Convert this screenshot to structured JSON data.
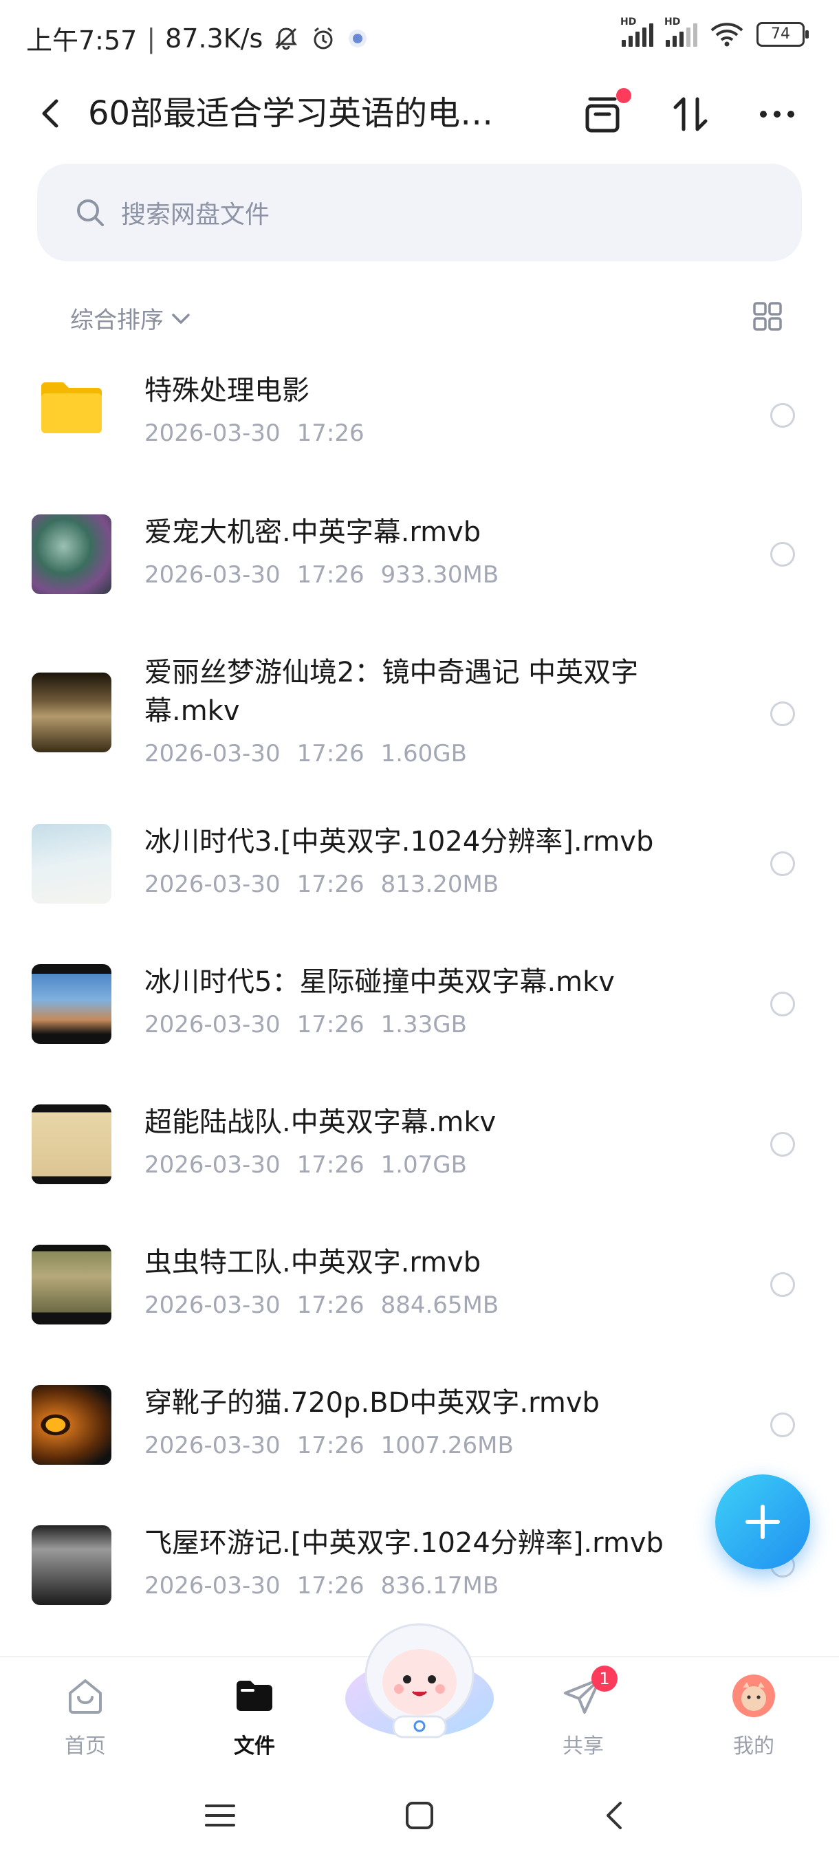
{
  "status_bar": {
    "time": "上午7:57",
    "net_speed": "87.3K/s",
    "battery": "74",
    "signal_tag": "HD"
  },
  "header": {
    "title": "60部最适合学习英语的电…"
  },
  "search": {
    "placeholder": "搜索网盘文件"
  },
  "sort": {
    "label": "综合排序"
  },
  "files": [
    {
      "name": "特殊处理电影",
      "date": "2026-03-30",
      "time": "17:26",
      "size": "",
      "type": "folder"
    },
    {
      "name": "爱宠大机密.中英字幕.rmvb",
      "date": "2026-03-30",
      "time": "17:26",
      "size": "933.30MB",
      "type": "video"
    },
    {
      "name": "爱丽丝梦游仙境2：镜中奇遇记 中英双字幕.mkv",
      "date": "2026-03-30",
      "time": "17:26",
      "size": "1.60GB",
      "type": "video"
    },
    {
      "name": "冰川时代3.[中英双字.1024分辨率].rmvb",
      "date": "2026-03-30",
      "time": "17:26",
      "size": "813.20MB",
      "type": "video"
    },
    {
      "name": "冰川时代5：星际碰撞中英双字幕.mkv",
      "date": "2026-03-30",
      "time": "17:26",
      "size": "1.33GB",
      "type": "video"
    },
    {
      "name": "超能陆战队.中英双字幕.mkv",
      "date": "2026-03-30",
      "time": "17:26",
      "size": "1.07GB",
      "type": "video"
    },
    {
      "name": "虫虫特工队.中英双字.rmvb",
      "date": "2026-03-30",
      "time": "17:26",
      "size": "884.65MB",
      "type": "video"
    },
    {
      "name": "穿靴子的猫.720p.BD中英双字.rmvb",
      "date": "2026-03-30",
      "time": "17:26",
      "size": "1007.26MB",
      "type": "video"
    },
    {
      "name": "飞屋环游记.[中英双字.1024分辨率].rmvb",
      "date": "2026-03-30",
      "time": "17:26",
      "size": "836.17MB",
      "type": "video"
    }
  ],
  "tabs": [
    {
      "label": "首页",
      "icon": "home-icon"
    },
    {
      "label": "文件",
      "icon": "folder-icon"
    },
    {
      "label": "共享",
      "icon": "share-icon",
      "badge": "1"
    },
    {
      "label": "我的",
      "icon": "avatar-icon"
    }
  ],
  "colors": {
    "accent": "#1f8ff0",
    "badge": "#ff3b5c",
    "muted": "#a3a8b4"
  }
}
